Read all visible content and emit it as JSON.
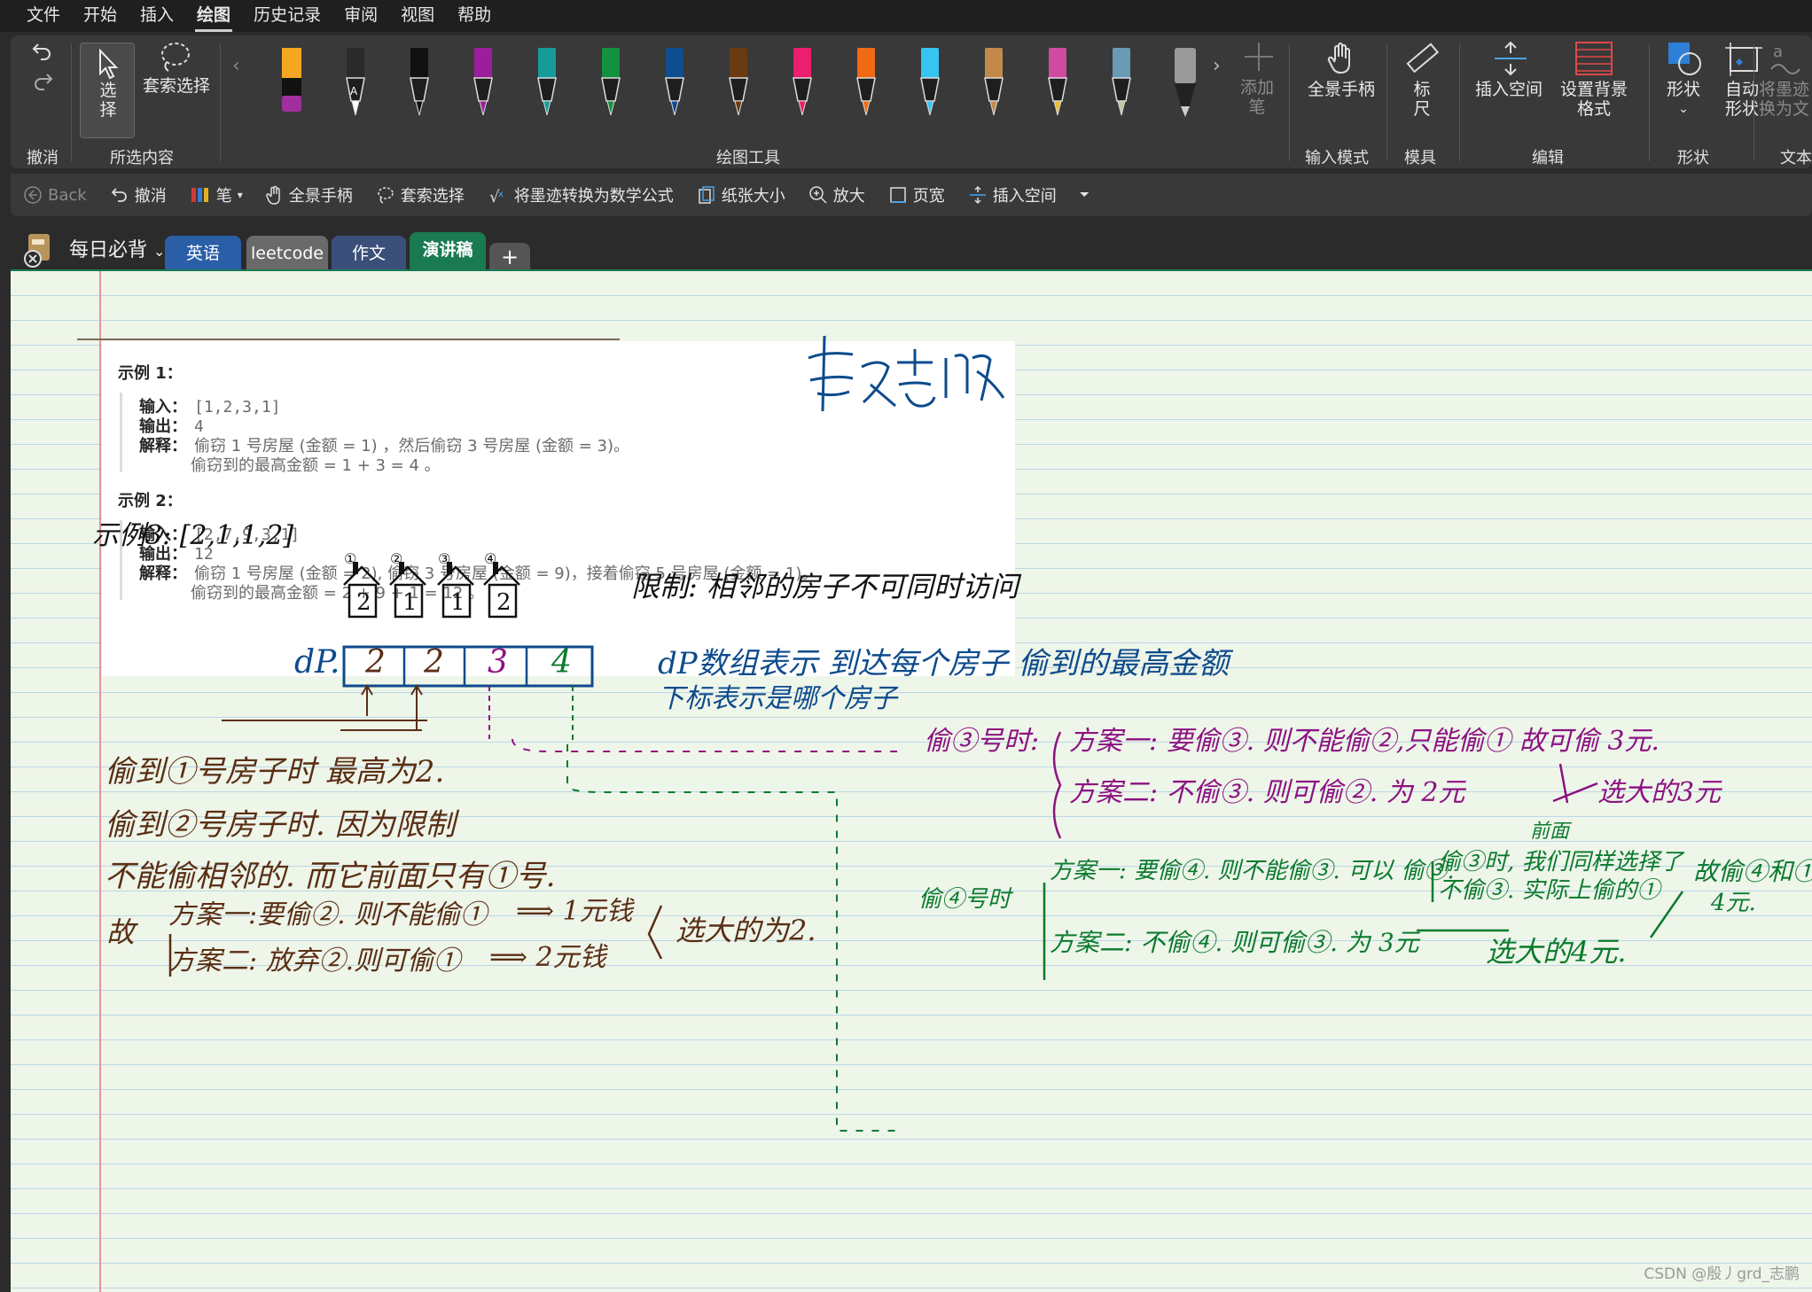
{
  "menu": [
    "文件",
    "开始",
    "插入",
    "绘图",
    "历史记录",
    "审阅",
    "视图",
    "帮助"
  ],
  "menu_active": "绘图",
  "ribbon": {
    "undo_group": "撤消",
    "select_button": "选\n择",
    "lasso_button": "套索选择",
    "selection_group": "所选内容",
    "drawing_tools_group": "绘图工具",
    "add_pen": "添加\n笔",
    "pan_button": "全景手柄",
    "input_mode_group": "输入模式",
    "ruler_button": "标\n尺",
    "stencils_group": "模具",
    "insert_space_button": "插入空间",
    "bg_format_button": "设置背景\n格式",
    "edit_group": "编辑",
    "shapes_button": "形状",
    "auto_shape_button": "自动\n形状",
    "shapes_group": "形状",
    "ink_to_text_button": "将墨迹\n换为文",
    "text_group": "文本",
    "pens": [
      {
        "name": "highlighter-orange",
        "color": "#f5a623",
        "tip": "#a22ea0"
      },
      {
        "name": "pen-black-a",
        "color": "#2a2a2a",
        "tip": "#ffffff"
      },
      {
        "name": "pen-black",
        "color": "#111111",
        "tip": "#111111"
      },
      {
        "name": "pen-purple",
        "color": "#9b1f9c",
        "tip": "#9b1f9c"
      },
      {
        "name": "pen-teal",
        "color": "#169b9b",
        "tip": "#169b9b"
      },
      {
        "name": "pen-green",
        "color": "#13913f",
        "tip": "#13913f"
      },
      {
        "name": "pen-blue",
        "color": "#0e4d8f",
        "tip": "#0e4d8f"
      },
      {
        "name": "pen-brown",
        "color": "#6a3a12",
        "tip": "#6a3a12"
      },
      {
        "name": "pen-pink",
        "color": "#ec1e6e",
        "tip": "#ec1e6e"
      },
      {
        "name": "pen-orange",
        "color": "#f06a14",
        "tip": "#f06a14"
      },
      {
        "name": "pen-lightblue",
        "color": "#38c4f0",
        "tip": "#38c4f0"
      },
      {
        "name": "pen-wood",
        "color": "#c28a4a",
        "tip": "#c28a4a"
      },
      {
        "name": "pen-rainbow",
        "color": "#d04aa0",
        "tip": "#e6c030"
      },
      {
        "name": "pen-galaxy",
        "color": "#6a9ab4",
        "tip": "#b8c8a0"
      },
      {
        "name": "pen-gray-marker",
        "color": "#9a9a9a",
        "tip": "#cfcfcf"
      }
    ]
  },
  "quickbar": {
    "back": "Back",
    "undo": "撤消",
    "pen": "笔",
    "pan": "全景手柄",
    "lasso": "套索选择",
    "ink_to_math": "将墨迹转换为数学公式",
    "paper_size": "纸张大小",
    "zoom": "放大",
    "page_width": "页宽",
    "insert_space": "插入空间"
  },
  "notebook": {
    "name": "每日必背"
  },
  "tabs": [
    {
      "label": "英语",
      "color": "#2a5fa8"
    },
    {
      "label": "leetcode",
      "color": "#6a6a6a"
    },
    {
      "label": "作文",
      "color": "#3a4f7a"
    },
    {
      "label": "演讲稿",
      "color": "#1a7a52"
    },
    {
      "label": "+",
      "color": "#555555"
    }
  ],
  "card": {
    "ex1_title": "示例 1：",
    "ex1_input_label": "输入：",
    "ex1_input": "[1,2,3,1]",
    "ex1_output_label": "输出：",
    "ex1_output": "4",
    "ex1_explain_label": "解释：",
    "ex1_explain": "偷窃 1 号房屋 (金额 = 1) ，然后偷窃 3 号房屋 (金额 = 3)。",
    "ex1_explain2": "偷窃到的最高金额 = 1 + 3 = 4 。",
    "ex2_title": "示例 2：",
    "ex2_input_label": "输入：",
    "ex2_input": "[2,7,9,3,1]",
    "ex2_output_label": "输出：",
    "ex2_output": "12",
    "ex2_explain_label": "解释：",
    "ex2_explain": "偷窃 1 号房屋 (金额 = 2), 偷窃 3 号房屋 (金额 = 9)，接着偷窃 5 号房屋 (金额 = 1)。",
    "ex2_explain2": "偷窃到的最高金额 = 2 + 9 + 1 = 12 。"
  },
  "ink": {
    "signature": "殷志鹏",
    "ex3": "示例3: [2,1,1,2]",
    "house_nums": [
      "①",
      "②",
      "③",
      "④"
    ],
    "house_vals": [
      "2",
      "1",
      "1",
      "2"
    ],
    "limit": "限制: 相邻的房子不可同时访问",
    "dp_label": "dP.",
    "dp_vals": [
      "2",
      "2",
      "3",
      "4"
    ],
    "dp_desc1": "dP数组表示 到达每个房子 偷到的最高金额",
    "dp_desc2": "下标表示是哪个房子",
    "brown1": "偷到①号房子时 最高为2.",
    "brown2": "偷到②号房子时. 因为限制",
    "brown3": "不能偷相邻的. 而它前面只有①号.",
    "brown_gu": "故",
    "brown_plan1": "方案一:要偷②. 则不能偷①",
    "brown_plan1_res": "⟹ 1元钱",
    "brown_plan2": "方案二: 放弃②.则可偷①",
    "brown_plan2_res": "⟹ 2元钱",
    "brown_choose": "选大的为2.",
    "purple_head": "偷③号时:",
    "purple_plan1": "方案一: 要偷③. 则不能偷②,只能偷① 故可偷 3元.",
    "purple_plan2": "方案二: 不偷③. 则可偷②. 为 2元",
    "purple_choose": "选大的3元",
    "green_head": "偷④号时",
    "green_plan1": "方案一: 要偷④. 则不能偷③. 可以 偷③.",
    "green_front": "前面",
    "green_note1": "偷③时, 我们同样选择了",
    "green_note2": "不偷③. 实际上偷的①",
    "green_result1": "故偷④和①",
    "green_result2": "4元.",
    "green_plan2": "方案二: 不偷④. 则可偷③. 为 3元",
    "green_choose": "选大的4元."
  },
  "watermark": "CSDN @殷丿grd_志鹏"
}
